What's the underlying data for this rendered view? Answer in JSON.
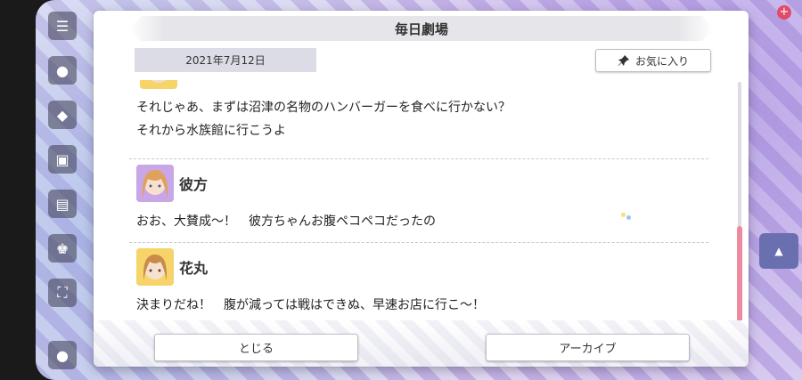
{
  "dialog": {
    "title": "毎日劇場",
    "date": "2021年7月12日",
    "favorite_label": "お気に入り"
  },
  "entries": [
    {
      "speaker": "",
      "lines": [
        "それじゃあ、まずは沼津の名物のハンバーガーを食べに行かない？",
        "それから水族館に行こうよ"
      ]
    },
    {
      "speaker": "彼方",
      "lines": [
        "おお、大賛成〜！　彼方ちゃんお腹ペコペコだったの"
      ]
    },
    {
      "speaker": "花丸",
      "lines": [
        "決まりだね！　腹が減っては戦はできぬ、早速お店に行こ〜！"
      ]
    }
  ],
  "footer": {
    "close_label": "とじる",
    "archive_label": "アーカイブ"
  },
  "colors": {
    "scroll_thumb": "#ee8aa0",
    "avatar_kanata_bg": "#c9a6e6",
    "avatar_hanamaru_bg": "#f6d46a"
  }
}
